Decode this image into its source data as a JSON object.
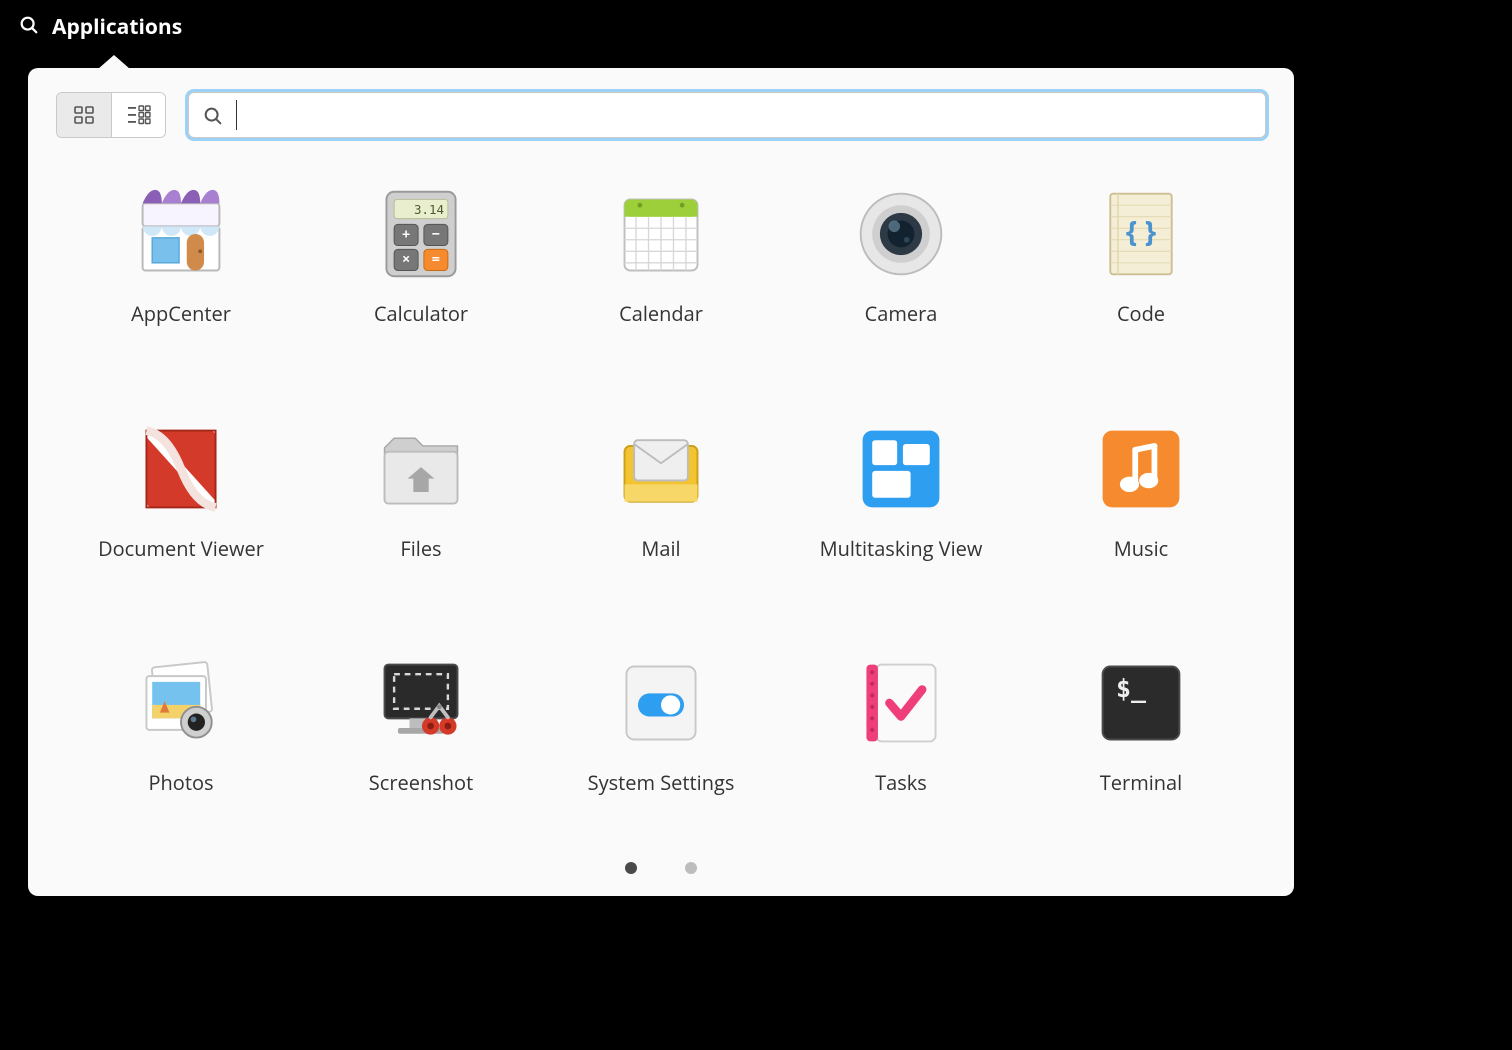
{
  "topbar": {
    "label": "Applications"
  },
  "search": {
    "placeholder": "",
    "value": ""
  },
  "view": {
    "active": "grid"
  },
  "apps": [
    {
      "id": "appcenter",
      "label": "AppCenter"
    },
    {
      "id": "calculator",
      "label": "Calculator",
      "display": "3.14"
    },
    {
      "id": "calendar",
      "label": "Calendar"
    },
    {
      "id": "camera",
      "label": "Camera"
    },
    {
      "id": "code",
      "label": "Code"
    },
    {
      "id": "document-viewer",
      "label": "Document Viewer"
    },
    {
      "id": "files",
      "label": "Files"
    },
    {
      "id": "mail",
      "label": "Mail"
    },
    {
      "id": "multitasking",
      "label": "Multitasking View"
    },
    {
      "id": "music",
      "label": "Music"
    },
    {
      "id": "photos",
      "label": "Photos"
    },
    {
      "id": "screenshot",
      "label": "Screenshot"
    },
    {
      "id": "system-settings",
      "label": "System Settings"
    },
    {
      "id": "tasks",
      "label": "Tasks"
    },
    {
      "id": "terminal",
      "label": "Terminal",
      "prompt": "$_"
    }
  ],
  "pager": {
    "pages": 2,
    "current": 1
  }
}
